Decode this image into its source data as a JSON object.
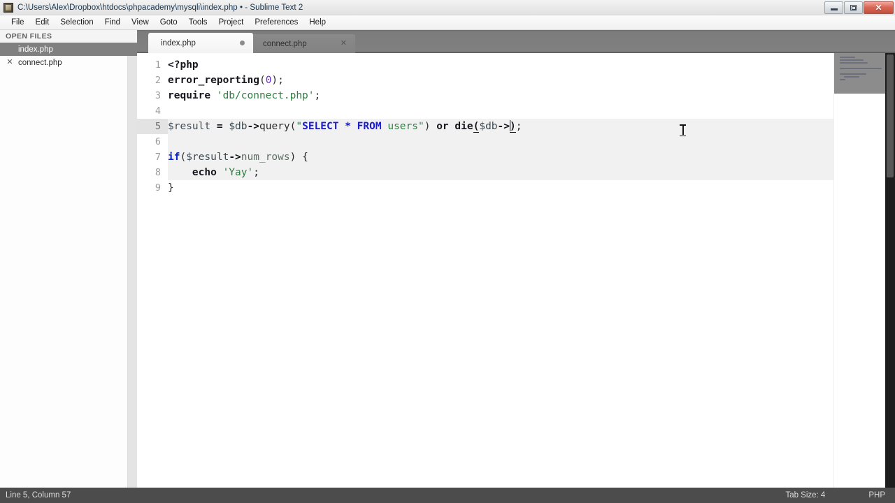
{
  "window": {
    "title": "C:\\Users\\Alex\\Dropbox\\htdocs\\phpacademy\\mysqli\\index.php • - Sublime Text 2",
    "app_icon": "sublime-text-icon",
    "controls": {
      "minimize": "minimize-icon",
      "restore": "restore-icon",
      "close": "✕"
    }
  },
  "menubar": {
    "items": [
      {
        "label": "File"
      },
      {
        "label": "Edit"
      },
      {
        "label": "Selection"
      },
      {
        "label": "Find"
      },
      {
        "label": "View"
      },
      {
        "label": "Goto"
      },
      {
        "label": "Tools"
      },
      {
        "label": "Project"
      },
      {
        "label": "Preferences"
      },
      {
        "label": "Help"
      }
    ]
  },
  "sidebar": {
    "header": "OPEN FILES",
    "files": [
      {
        "name": "index.php",
        "close_icon": "",
        "active": true
      },
      {
        "name": "connect.php",
        "close_icon": "✕",
        "active": false
      }
    ]
  },
  "tabs": [
    {
      "label": "index.php",
      "dirty": true,
      "active": true,
      "close_icon": ""
    },
    {
      "label": "connect.php",
      "dirty": false,
      "active": false,
      "close_icon": "✕"
    }
  ],
  "editor": {
    "gutter": [
      "1",
      "2",
      "3",
      "4",
      "5",
      "6",
      "7",
      "8",
      "9"
    ],
    "current_line": 5,
    "lines": [
      {
        "n": 1,
        "tokens": [
          {
            "t": "<?php",
            "c": "tok-dark-bold"
          }
        ]
      },
      {
        "n": 2,
        "tokens": [
          {
            "t": "error_reporting",
            "c": "tok-dark-bold"
          },
          {
            "t": "(",
            "c": "tok-punct"
          },
          {
            "t": "0",
            "c": "tok-num"
          },
          {
            "t": ")",
            "c": "tok-punct"
          },
          {
            "t": ";",
            "c": "tok-punct"
          }
        ]
      },
      {
        "n": 3,
        "tokens": [
          {
            "t": "require",
            "c": "tok-dark-bold"
          },
          {
            "t": " ",
            "c": "tok-plain"
          },
          {
            "t": "'db/connect.php'",
            "c": "tok-str"
          },
          {
            "t": ";",
            "c": "tok-punct"
          }
        ]
      },
      {
        "n": 4,
        "tokens": []
      },
      {
        "n": 5,
        "tokens": [
          {
            "t": "$result",
            "c": "tok-var"
          },
          {
            "t": " ",
            "c": "tok-plain"
          },
          {
            "t": "=",
            "c": "tok-dark-bold"
          },
          {
            "t": " ",
            "c": "tok-plain"
          },
          {
            "t": "$db",
            "c": "tok-var"
          },
          {
            "t": "->",
            "c": "tok-arrow"
          },
          {
            "t": "query",
            "c": "tok-plain"
          },
          {
            "t": "(",
            "c": "tok-punct"
          },
          {
            "t": "\"",
            "c": "tok-str"
          },
          {
            "t": "SELECT * FROM",
            "c": "tok-sql"
          },
          {
            "t": " ",
            "c": "tok-plain"
          },
          {
            "t": "users\"",
            "c": "tok-str"
          },
          {
            "t": ")",
            "c": "tok-punct"
          },
          {
            "t": " ",
            "c": "tok-plain"
          },
          {
            "t": "or",
            "c": "tok-dark-bold"
          },
          {
            "t": " ",
            "c": "tok-plain"
          },
          {
            "t": "die",
            "c": "tok-dark-bold"
          },
          {
            "t": "(",
            "c": "tok-bracket-match"
          },
          {
            "t": "$db",
            "c": "tok-var"
          },
          {
            "t": "->",
            "c": "tok-arrow"
          },
          {
            "t": "CARET",
            "c": "caret"
          },
          {
            "t": ")",
            "c": "tok-bracket-match"
          },
          {
            "t": ";",
            "c": "tok-punct"
          }
        ]
      },
      {
        "n": 6,
        "tokens": []
      },
      {
        "n": 7,
        "tokens": [
          {
            "t": "if",
            "c": "tok-kw"
          },
          {
            "t": "(",
            "c": "tok-punct"
          },
          {
            "t": "$result",
            "c": "tok-var"
          },
          {
            "t": "->",
            "c": "tok-arrow"
          },
          {
            "t": "num_rows",
            "c": "tok-prop"
          },
          {
            "t": ")",
            "c": "tok-punct"
          },
          {
            "t": " ",
            "c": "tok-plain"
          },
          {
            "t": "{",
            "c": "tok-punct"
          }
        ]
      },
      {
        "n": 8,
        "tokens": [
          {
            "t": "    ",
            "c": "tok-plain"
          },
          {
            "t": "echo",
            "c": "tok-dark-bold"
          },
          {
            "t": " ",
            "c": "tok-plain"
          },
          {
            "t": "'Yay'",
            "c": "tok-str"
          },
          {
            "t": ";",
            "c": "tok-punct"
          }
        ]
      },
      {
        "n": 9,
        "tokens": [
          {
            "t": "}",
            "c": "tok-punct"
          }
        ]
      }
    ],
    "minimap": {
      "name": "code-minimap",
      "viewport_visible": true
    }
  },
  "statusbar": {
    "caret_position": "Line 5, Column 57",
    "tab_size": "Tab Size: 4",
    "language": "PHP"
  },
  "colors": {
    "tabbar_bg": "#808080",
    "statusbar_bg": "#4c4c4c",
    "sidebar_active_bg": "#808080",
    "highlight_bg": "#f1f1f1",
    "keyword": "#0a22cc",
    "string": "#2f7d42",
    "number": "#6c2fc9",
    "sql": "#1a1ad0"
  }
}
